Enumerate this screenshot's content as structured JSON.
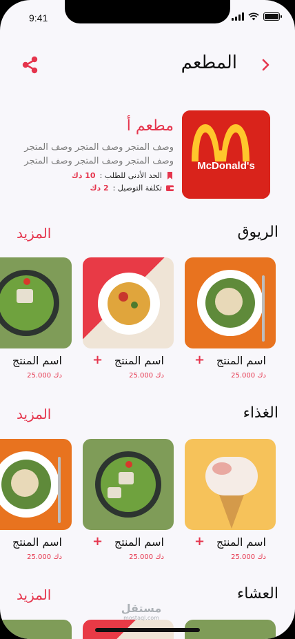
{
  "status_bar": {
    "time": "9:41"
  },
  "header": {
    "title": "المطعم"
  },
  "restaurant": {
    "name": "مطعم أ",
    "logo_text": "McDonald's",
    "description_lines": [
      "وصف المتجر وصف المتجر وصف المتجر",
      "وصف المتجر وصف المتجر وصف المتجر"
    ],
    "min_order_label": "الحد الأدنى للطلب :",
    "min_order_value": "10 دك",
    "delivery_label": "تكلفة التوصيل :",
    "delivery_value": "2 دك"
  },
  "sections": [
    {
      "title": "الريوق",
      "more": "المزيد",
      "products": [
        {
          "name": "اسم المنتج",
          "price": "دك 25.000",
          "add": "+",
          "image": "chicken-salad-orange"
        },
        {
          "name": "اسم المنتج",
          "price": "دك 25.000",
          "add": "+",
          "image": "pasta-salad"
        },
        {
          "name": "اسم المنتج",
          "price": "دك 25.000",
          "add": "+",
          "image": "green-salad"
        }
      ]
    },
    {
      "title": "الغذاء",
      "more": "المزيد",
      "products": [
        {
          "name": "اسم المنتج",
          "price": "دك 25.000",
          "add": "+",
          "image": "ice-cream-cone"
        },
        {
          "name": "اسم المنتج",
          "price": "دك 25.000",
          "add": "+",
          "image": "green-salad"
        },
        {
          "name": "اسم المنتج",
          "price": "دك 25.000",
          "add": "+",
          "image": "chicken-salad-orange"
        }
      ]
    },
    {
      "title": "العشاء",
      "more": "المزيد"
    }
  ],
  "watermark": {
    "ar": "مستقل",
    "en": "mostaql.com"
  },
  "colors": {
    "accent": "#e5354d",
    "background": "#f8f7fb"
  }
}
